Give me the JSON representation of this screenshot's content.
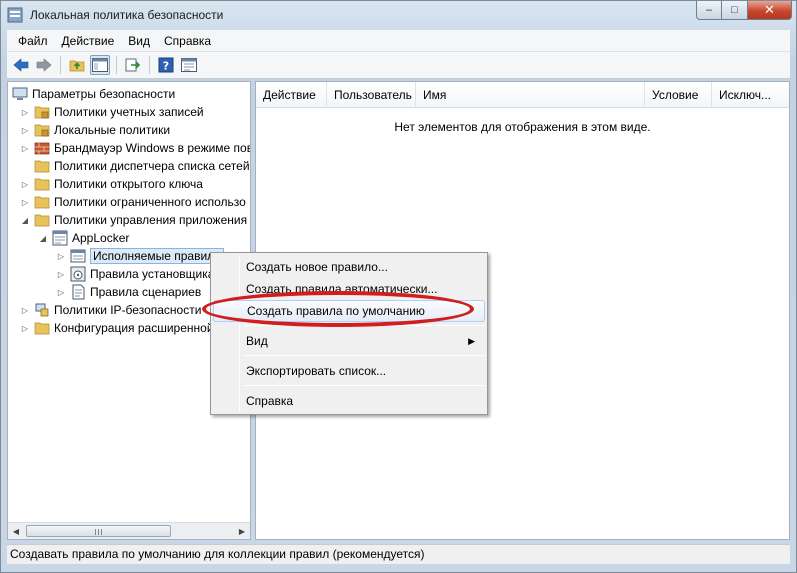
{
  "window": {
    "title": "Локальная политика безопасности",
    "minimize": "–",
    "maximize": "□",
    "close": "✕"
  },
  "menubar": [
    "Файл",
    "Действие",
    "Вид",
    "Справка"
  ],
  "tree": {
    "root": "Параметры безопасности",
    "items": [
      {
        "label": "Политики учетных записей"
      },
      {
        "label": "Локальные политики"
      },
      {
        "label": "Брандмауэр Windows в режиме пов"
      },
      {
        "label": "Политики диспетчера списка сетей"
      },
      {
        "label": "Политики открытого ключа"
      },
      {
        "label": "Политики ограниченного использо"
      },
      {
        "label": "Политики управления приложения"
      },
      {
        "label": "AppLocker"
      },
      {
        "label": "Исполняемые правила"
      },
      {
        "label": "Правила установщика"
      },
      {
        "label": "Правила сценариев"
      },
      {
        "label": "Политики IP-безопасности"
      },
      {
        "label": "Конфигурация расширенной"
      }
    ]
  },
  "list": {
    "columns": [
      "Действие",
      "Пользователь",
      "Имя",
      "Условие",
      "Исключ..."
    ],
    "empty_message": "Нет элементов для отображения в этом виде."
  },
  "context_menu": {
    "items": [
      {
        "label": "Создать новое правило..."
      },
      {
        "label": "Создать правила автоматически..."
      },
      {
        "label": "Создать правила по умолчанию"
      },
      {
        "label": "Вид"
      },
      {
        "label": "Экспортировать список..."
      },
      {
        "label": "Справка"
      }
    ],
    "submenu_arrow": "▶"
  },
  "statusbar": {
    "text": "Создавать правила по умолчанию для коллекции правил (рекомендуется)"
  },
  "colors": {
    "highlight_ellipse": "#d11d1d",
    "selection": "#dce9f7"
  }
}
